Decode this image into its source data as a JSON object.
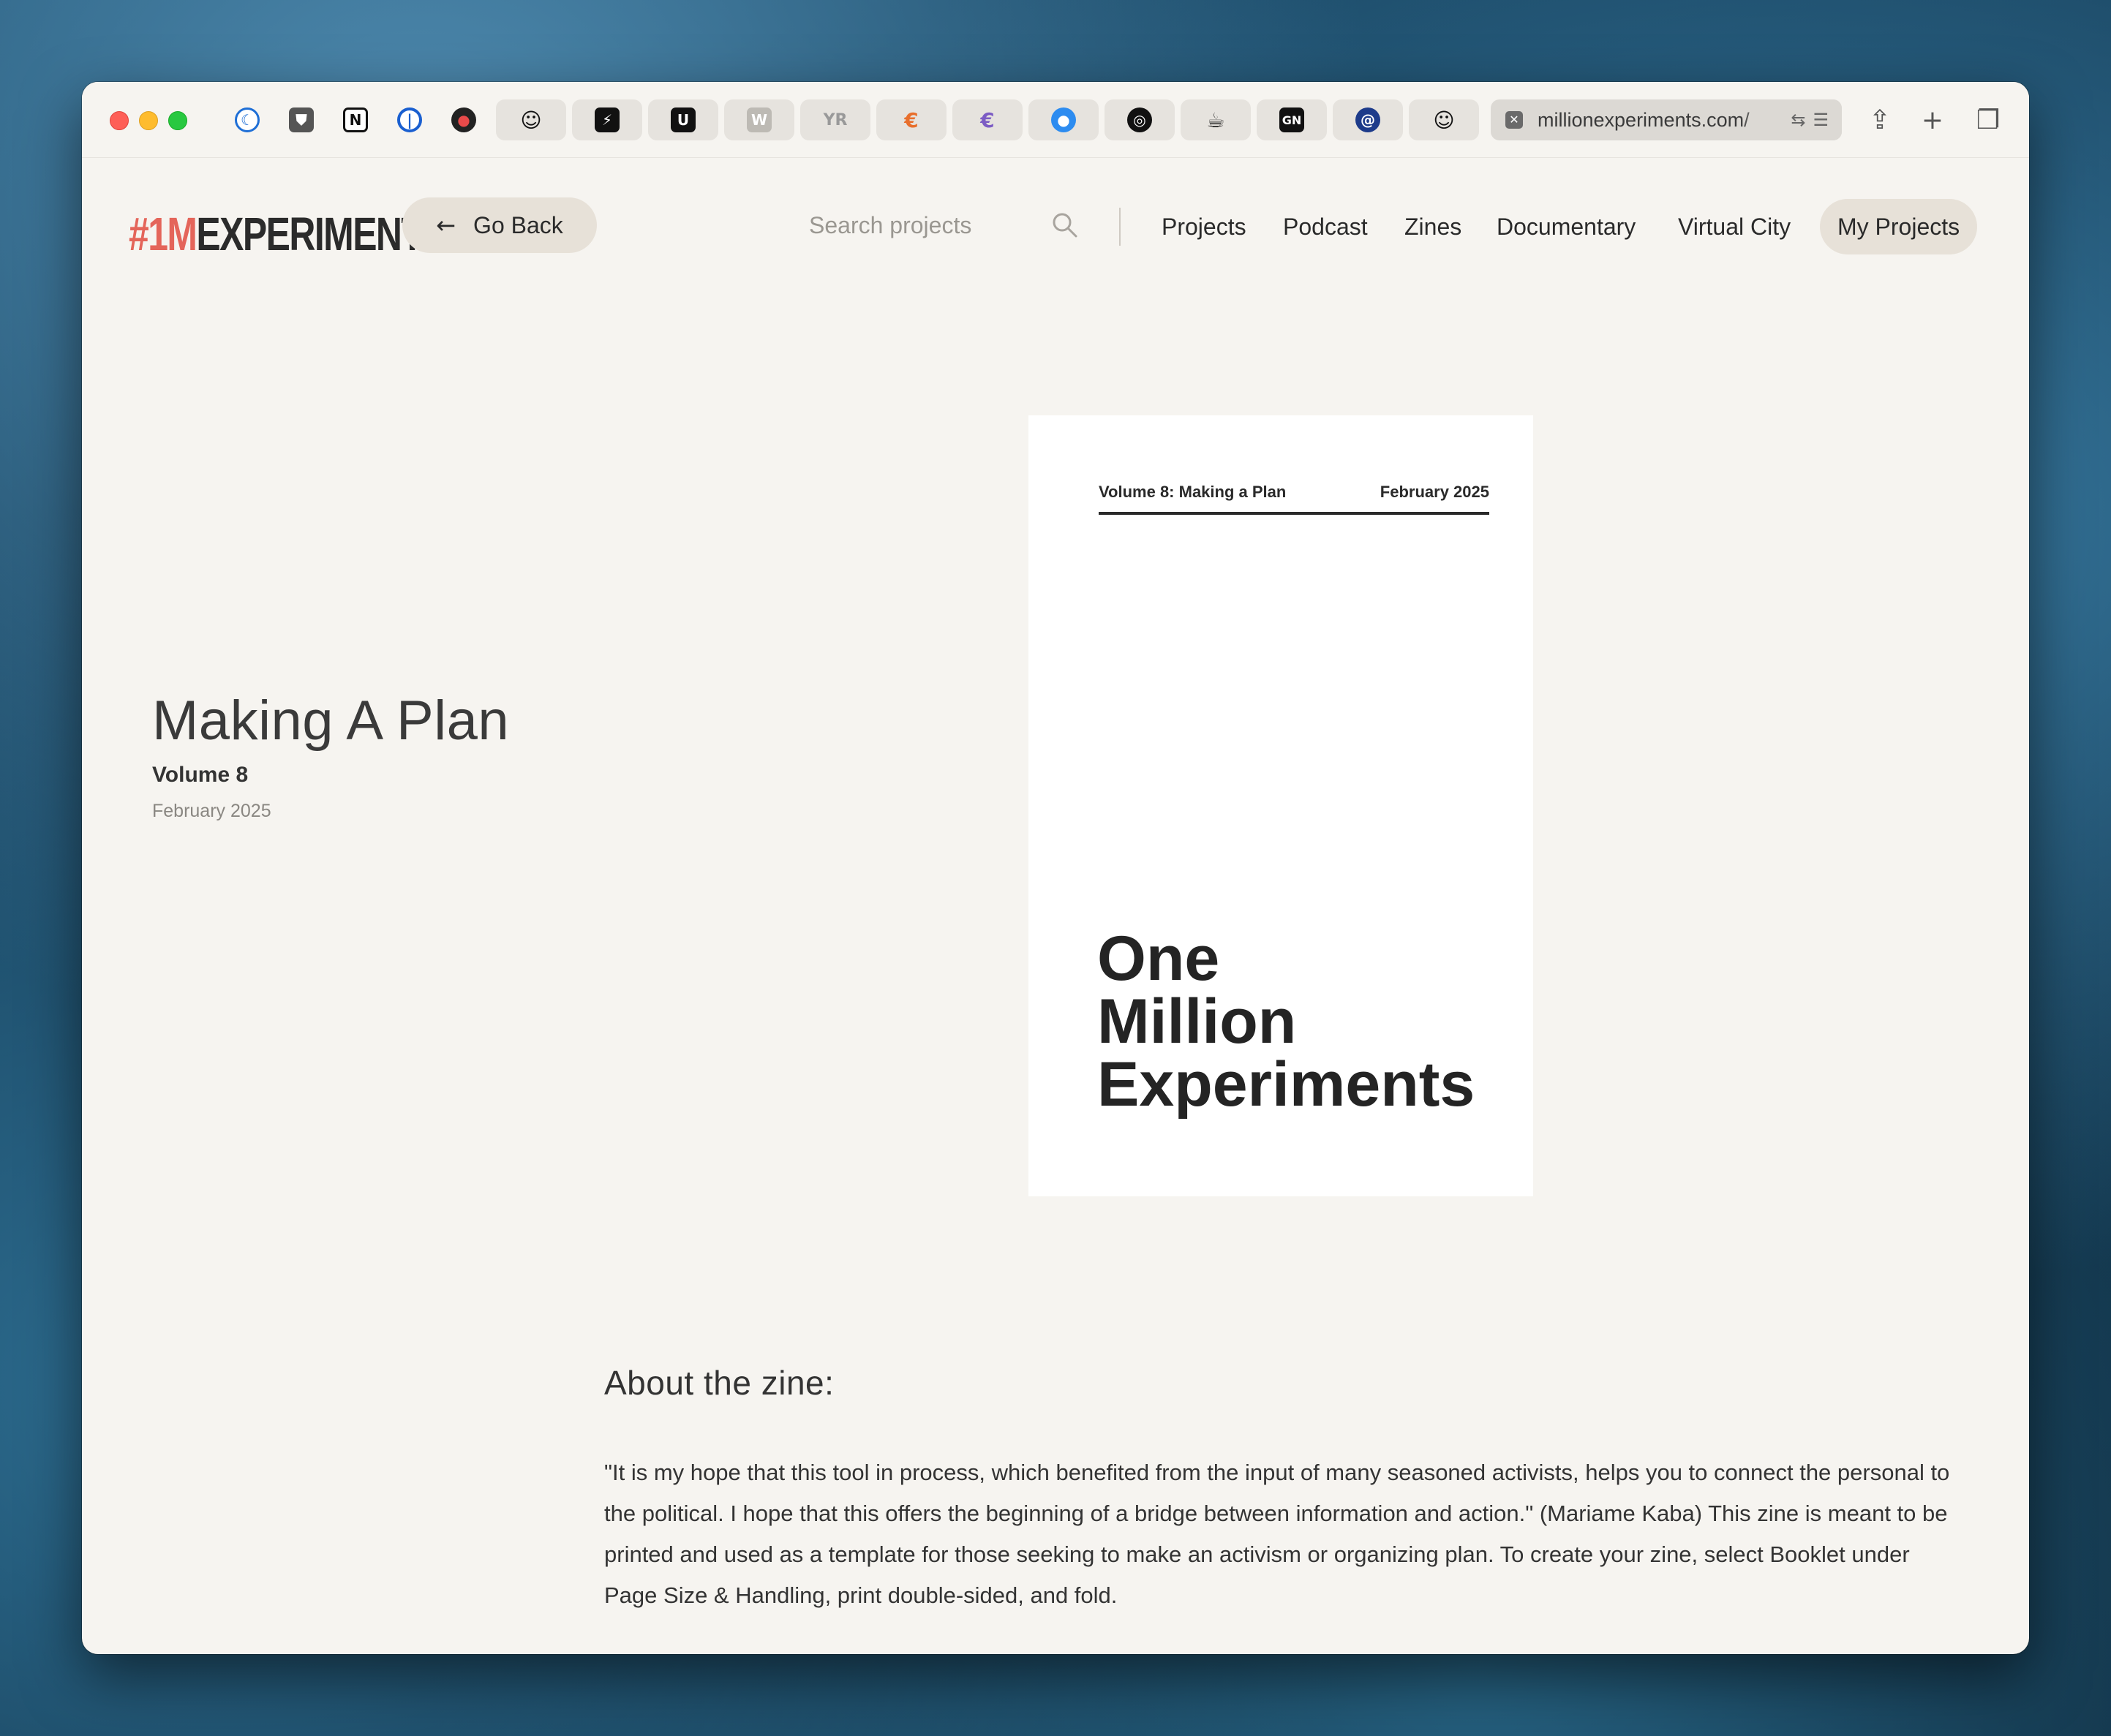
{
  "browser": {
    "address_text": "millionexperiments.com/",
    "tabs": [
      {
        "name": "moon-tab-icon",
        "glyph": "☾"
      },
      {
        "name": "shield-tab-icon",
        "glyph": "⛊"
      },
      {
        "name": "notion-tab-icon",
        "glyph": "N"
      },
      {
        "name": "onepassword-tab-icon",
        "glyph": "①"
      },
      {
        "name": "pinboard-tab-icon",
        "glyph": "◉"
      },
      {
        "name": "avatar-tab-icon",
        "glyph": "☺"
      },
      {
        "name": "bolt-tab-icon",
        "glyph": "⚡"
      },
      {
        "name": "u-tab-icon",
        "glyph": "U"
      },
      {
        "name": "w-tab-icon",
        "glyph": "W"
      },
      {
        "name": "yr-tab-icon",
        "glyph": "YR"
      },
      {
        "name": "apple-rainbow-tab-icon",
        "glyph": "€"
      },
      {
        "name": "apple-rainbow-2-tab-icon",
        "glyph": "€"
      },
      {
        "name": "apple-blue-tab-icon",
        "glyph": ""
      },
      {
        "name": "github-tab-icon",
        "glyph": "◎"
      },
      {
        "name": "coffee-tab-icon",
        "glyph": "☕"
      },
      {
        "name": "gn-tab-icon",
        "glyph": "GN"
      },
      {
        "name": "at-tab-icon",
        "glyph": "@"
      },
      {
        "name": "avatar-2-tab-icon",
        "glyph": "☺"
      }
    ]
  },
  "header": {
    "logo_accent": "#1M",
    "logo_rest": "EXPERIMENTS",
    "go_back_label": "Go Back",
    "search_placeholder": "Search projects",
    "nav": [
      "Projects",
      "Podcast",
      "Zines",
      "Documentary",
      "Virtual City",
      "My Projects"
    ],
    "active_nav": "My Projects"
  },
  "zine": {
    "title": "Making A Plan",
    "volume": "Volume 8",
    "date": "February 2025",
    "cover": {
      "header_left": "Volume 8: Making a Plan",
      "header_right": "February 2025",
      "title_lines": [
        "One",
        "Million",
        "Experiments"
      ]
    }
  },
  "about": {
    "heading": "About the zine:",
    "body": "\"It is my hope that this tool in process, which benefited from the input of many seasoned activists, helps you to connect the personal to the political. I hope that this offers the beginning of a bridge between information and action.\" (Mariame Kaba) This zine is meant to be printed and used as a template for those seeking to make an activism or organizing plan. To create your zine, select Booklet under Page Size & Handling, print double-sided, and fold."
  },
  "colors": {
    "accent": "#e4655a",
    "page_bg": "#f6f4f0",
    "pill_bg": "#e7e1d8"
  }
}
